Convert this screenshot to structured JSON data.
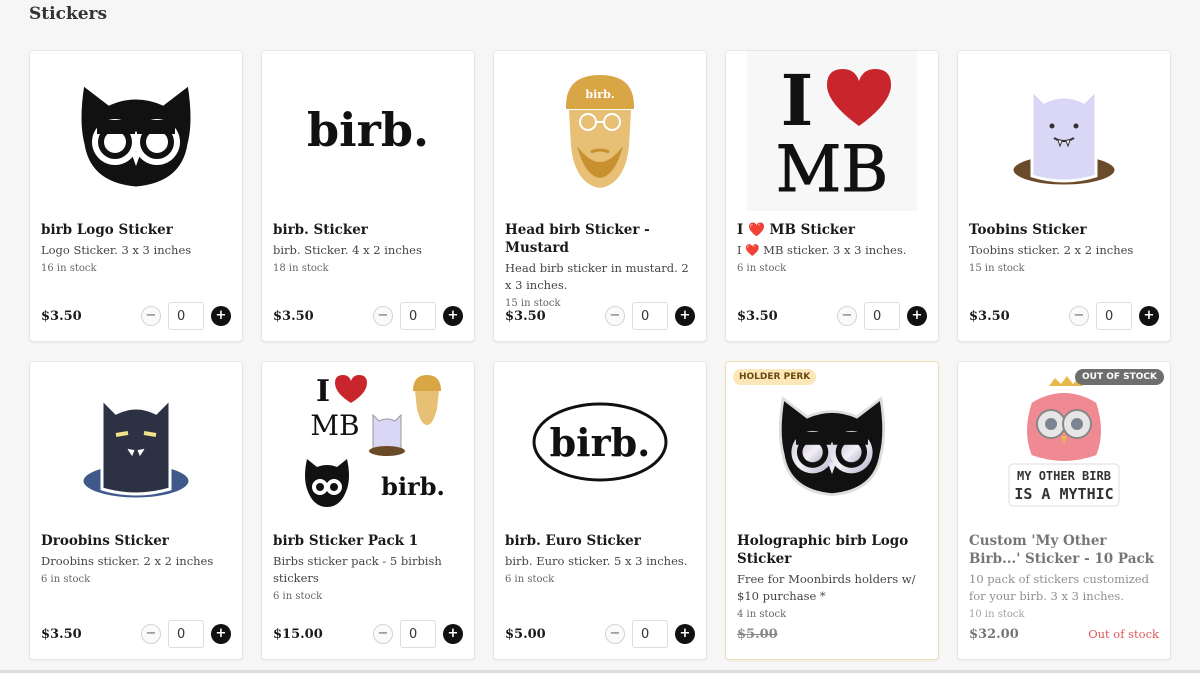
{
  "section_title": "Stickers",
  "qty_default": "0",
  "minus_label": "−",
  "plus_label": "+",
  "products": [
    {
      "name": "birb Logo Sticker",
      "desc": "Logo Sticker. 3 x 3 inches",
      "stock": "16 in stock",
      "price": "$3.50"
    },
    {
      "name": "birb. Sticker",
      "desc": "birb. Sticker. 4 x 2 inches",
      "stock": "18 in stock",
      "price": "$3.50"
    },
    {
      "name": "Head birb Sticker - Mustard",
      "desc": "Head birb sticker in mustard. 2 x 3 inches.",
      "stock": "15 in stock",
      "price": "$3.50"
    },
    {
      "name": "I ❤️ MB Sticker",
      "desc": "I ❤️ MB sticker. 3 x 3 inches.",
      "stock": "6 in stock",
      "price": "$3.50"
    },
    {
      "name": "Toobins Sticker",
      "desc": "Toobins sticker. 2 x 2 inches",
      "stock": "15 in stock",
      "price": "$3.50"
    },
    {
      "name": "Droobins Sticker",
      "desc": "Droobins sticker. 2 x 2 inches",
      "stock": "6 in stock",
      "price": "$3.50"
    },
    {
      "name": "birb Sticker Pack 1",
      "desc": "Birbs sticker pack - 5 birbish stickers",
      "stock": "6 in stock",
      "price": "$15.00"
    },
    {
      "name": "birb. Euro Sticker",
      "desc": "birb. Euro sticker. 5 x 3 inches.",
      "stock": "6 in stock",
      "price": "$5.00"
    },
    {
      "name": "Holographic birb Logo Sticker",
      "desc": "Free for Moonbirds holders w/ $10 purchase *",
      "stock": "4 in stock",
      "price": "$5.00",
      "badge": "HOLDER PERK"
    },
    {
      "name": "Custom 'My Other Birb...' Sticker - 10 Pack",
      "desc": "10 pack of stickers customized for your birb. 3 x 3 inches.",
      "stock": "10 in stock",
      "price": "$32.00",
      "badge": "OUT OF STOCK",
      "status": "Out of stock"
    }
  ],
  "images": {
    "birb_wordmark": "birb.",
    "head_cap_text": "birb.",
    "ilovemb_i": "I",
    "ilovemb_mb": "MB",
    "pack_i": "I",
    "pack_mb": "MB",
    "pack_birb": "birb.",
    "euro_text": "birb.",
    "mythic_line1": "MY OTHER BIRB",
    "mythic_line2": "IS A MYTHIC"
  },
  "colors": {
    "mustard": "#d9a646",
    "heart": "#c9252c",
    "ghost": "#d9d6f6",
    "droobins": "#2c3144",
    "badge_holder_bg": "#fbe7b7",
    "out_of_stock_text": "#e05555"
  }
}
